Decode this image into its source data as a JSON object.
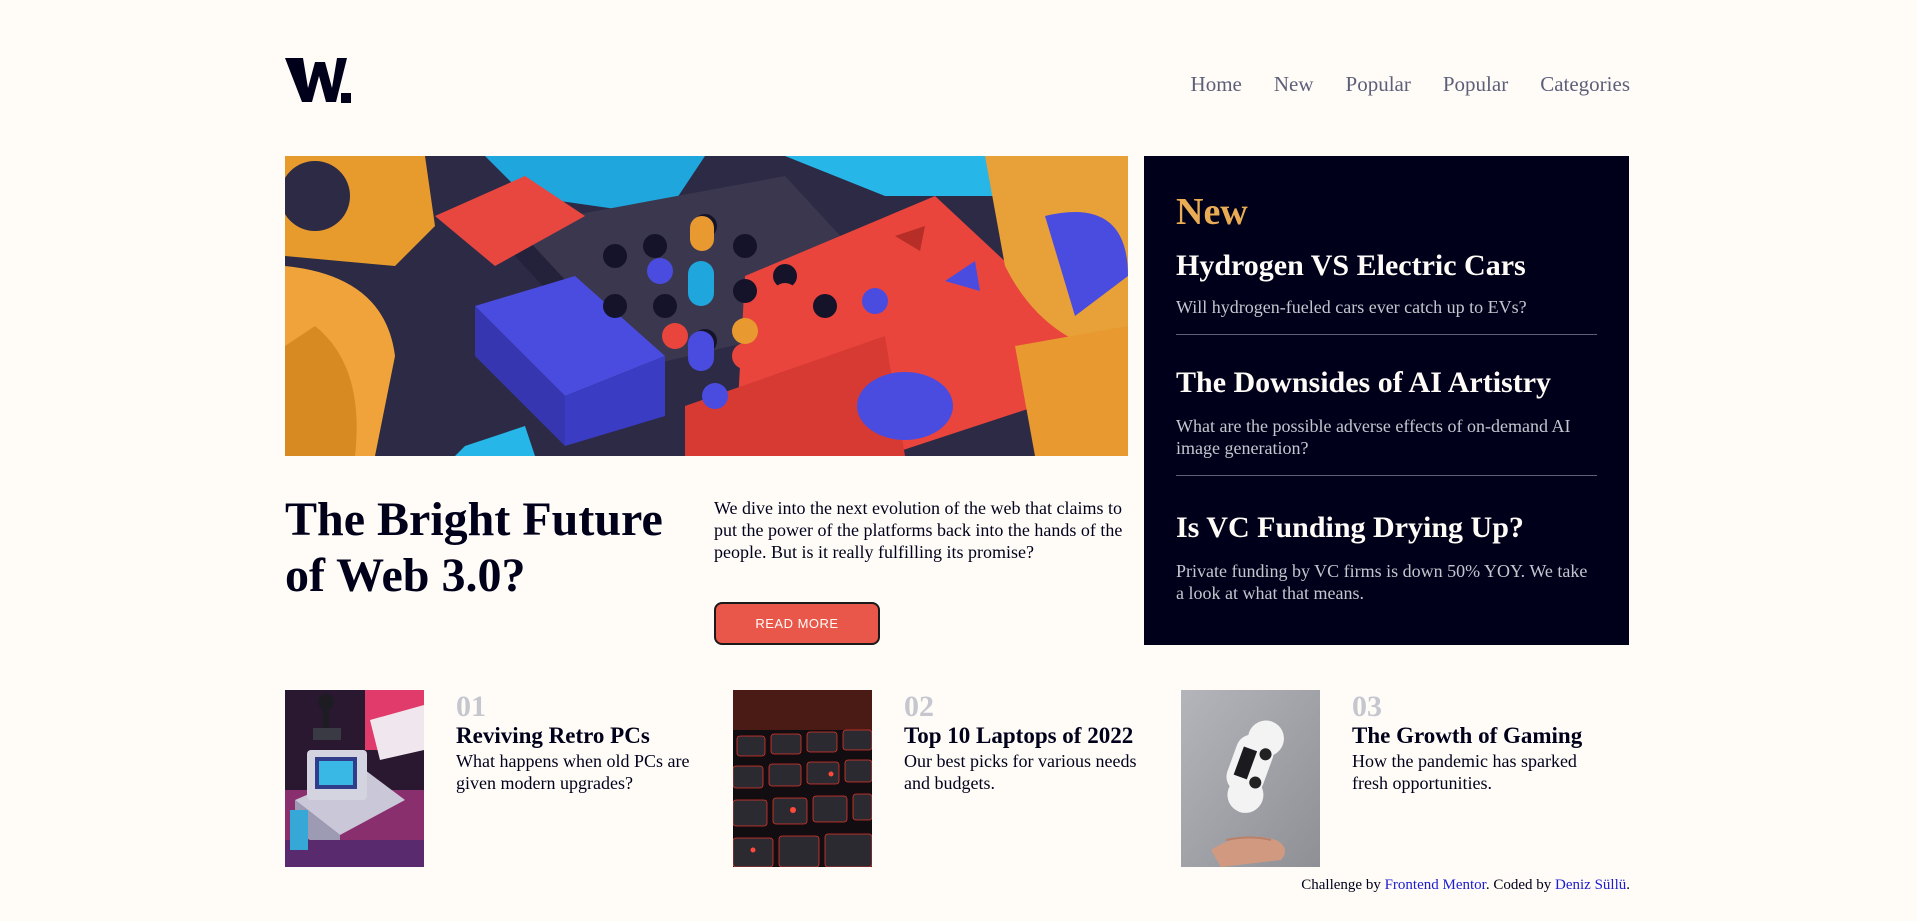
{
  "header": {
    "logo_text": "W.",
    "nav": [
      "Home",
      "New",
      "Popular",
      "Popular",
      "Categories"
    ]
  },
  "hero": {
    "title": "The Bright Future of Web 3.0?",
    "description": "We dive into the next evolution of the web that claims to put the power of the platforms back into the hands of the people. But is it really fulfilling its promise?",
    "button_label": "READ MORE"
  },
  "new_panel": {
    "heading": "New",
    "items": [
      {
        "title": "Hydrogen VS Electric Cars",
        "description": "Will hydrogen-fueled cars ever catch up to EVs?"
      },
      {
        "title": "The Downsides of AI Artistry",
        "description": "What are the possible adverse effects of on-demand AI image generation?"
      },
      {
        "title": "Is VC Funding Drying Up?",
        "description": "Private funding by VC firms is down 50% YOY. We take a look at what that means."
      }
    ]
  },
  "cards": [
    {
      "number": "01",
      "title": "Reviving Retro PCs",
      "description": "What happens when old PCs are given modern upgrades?"
    },
    {
      "number": "02",
      "title": "Top 10 Laptops of 2022",
      "description": "Our best picks for various needs and budgets."
    },
    {
      "number": "03",
      "title": "The Growth of Gaming",
      "description": "How the pandemic has sparked fresh opportunities."
    }
  ],
  "footer": {
    "prefix": "Challenge by ",
    "link1": "Frontend Mentor",
    "middle": ". Coded by ",
    "link2": "Deniz Süllü",
    "suffix": "."
  },
  "colors": {
    "background": "#fffcf8",
    "dark": "#00001a",
    "accent_red": "#e9564a",
    "accent_orange": "#e9ab53",
    "grayish_blue": "#c5c6ce",
    "dark_grayish_blue": "#5d5f79"
  }
}
